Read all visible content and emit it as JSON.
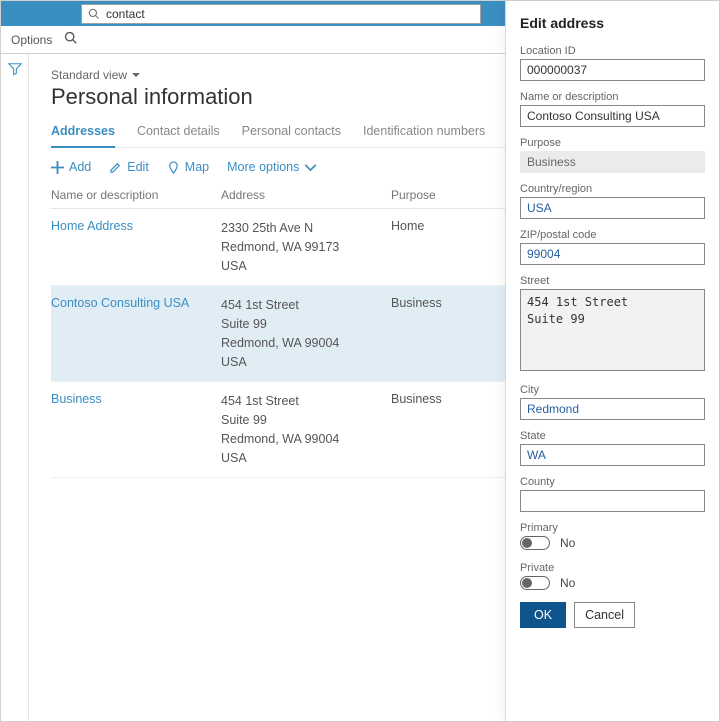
{
  "search": {
    "value": "contact"
  },
  "cmdbar": {
    "options": "Options"
  },
  "view": {
    "label": "Standard view"
  },
  "page": {
    "title": "Personal information"
  },
  "tabs": [
    {
      "label": "Addresses",
      "active": true
    },
    {
      "label": "Contact details",
      "active": false
    },
    {
      "label": "Personal contacts",
      "active": false
    },
    {
      "label": "Identification numbers",
      "active": false
    }
  ],
  "toolbar": {
    "add": "Add",
    "edit": "Edit",
    "map": "Map",
    "more": "More options"
  },
  "grid": {
    "columns": {
      "name": "Name or description",
      "address": "Address",
      "purpose": "Purpose"
    },
    "rows": [
      {
        "name": "Home Address",
        "address": "2330 25th Ave N\nRedmond, WA 99173\nUSA",
        "purpose": "Home",
        "selected": false
      },
      {
        "name": "Contoso Consulting USA",
        "address": "454 1st Street\nSuite 99\nRedmond, WA 99004\nUSA",
        "purpose": "Business",
        "selected": true
      },
      {
        "name": "Business",
        "address": "454 1st Street\nSuite 99\nRedmond, WA 99004\nUSA",
        "purpose": "Business",
        "selected": false
      }
    ]
  },
  "panel": {
    "title": "Edit address",
    "fields": {
      "location_id": {
        "label": "Location ID",
        "value": "000000037"
      },
      "name": {
        "label": "Name or description",
        "value": "Contoso Consulting USA"
      },
      "purpose": {
        "label": "Purpose",
        "value": "Business"
      },
      "country": {
        "label": "Country/region",
        "value": "USA"
      },
      "zip": {
        "label": "ZIP/postal code",
        "value": "99004"
      },
      "street": {
        "label": "Street",
        "value": "454 1st Street\nSuite 99"
      },
      "city": {
        "label": "City",
        "value": "Redmond"
      },
      "state": {
        "label": "State",
        "value": "WA"
      },
      "county": {
        "label": "County",
        "value": ""
      },
      "primary": {
        "label": "Primary",
        "value": "No"
      },
      "private": {
        "label": "Private",
        "value": "No"
      }
    },
    "buttons": {
      "ok": "OK",
      "cancel": "Cancel"
    }
  }
}
